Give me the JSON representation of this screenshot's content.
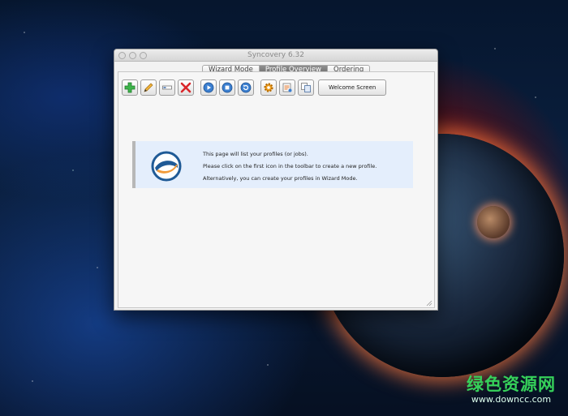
{
  "window": {
    "title": "Syncovery 6.32"
  },
  "tabs": [
    {
      "label": "Wizard Mode",
      "active": false
    },
    {
      "label": "Profile Overview",
      "active": true
    },
    {
      "label": "Ordering",
      "active": false
    }
  ],
  "toolbar": {
    "icons": [
      "add-profile-icon",
      "edit-profile-icon",
      "rename-profile-icon",
      "delete-profile-icon",
      "run-icon",
      "stop-icon",
      "refresh-icon",
      "settings-icon",
      "log-icon",
      "copy-icon"
    ],
    "welcome_label": "Welcome Screen"
  },
  "info": {
    "line1": "This page will list your profiles (or jobs).",
    "line2": "Please click on the first icon in the toolbar to create a new profile.",
    "line3": "Alternatively, you can create your profiles in Wizard Mode."
  },
  "watermark": {
    "chinese": "绿色资源网",
    "url": "www.downcc.com"
  },
  "colors": {
    "info_background": "#e4eefc",
    "active_tab": "#7a7a7a",
    "watermark_green": "#36d15a",
    "logo_blue": "#1f5a96",
    "logo_orange": "#f29b3a"
  }
}
